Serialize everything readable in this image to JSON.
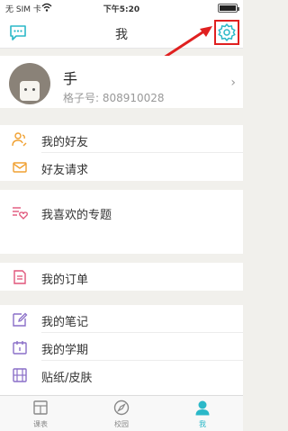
{
  "status": {
    "carrier": "无 SIM 卡",
    "time": "下午5:20"
  },
  "nav": {
    "title": "我"
  },
  "profile": {
    "name": "手",
    "id_text": "格子号: 808910028"
  },
  "menu": {
    "friends": "我的好友",
    "friend_requests": "好友请求",
    "favorite_topics": "我喜欢的专题",
    "orders": "我的订单",
    "notes": "我的笔记",
    "semester": "我的学期",
    "stickers": "贴纸/皮肤"
  },
  "tabs": [
    {
      "label": "课表",
      "icon": "grid-icon"
    },
    {
      "label": "校园",
      "icon": "compass-icon"
    },
    {
      "label": "我",
      "icon": "person-icon"
    }
  ],
  "colors": {
    "accent": "#2bb8c8",
    "highlight": "#e02020"
  }
}
